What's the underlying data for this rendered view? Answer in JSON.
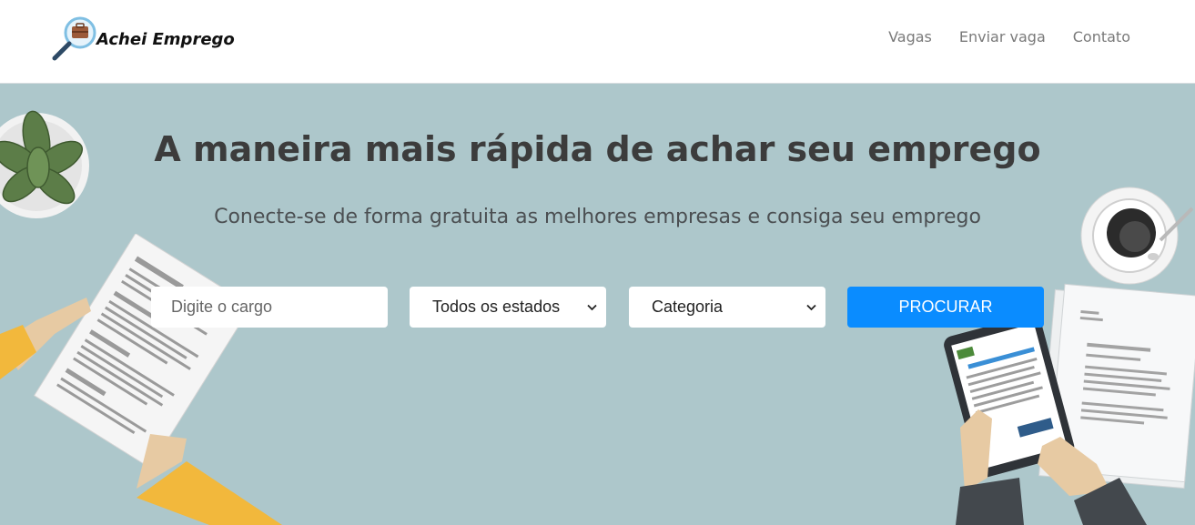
{
  "brand": {
    "name": "Achei Emprego"
  },
  "nav": {
    "items": [
      {
        "label": "Vagas"
      },
      {
        "label": "Enviar vaga"
      },
      {
        "label": "Contato"
      }
    ]
  },
  "hero": {
    "title": "A maneira mais rápida de achar seu emprego",
    "subtitle": "Conecte-se de forma gratuita as melhores empresas e consiga seu emprego"
  },
  "search": {
    "placeholder": "Digite o cargo",
    "states_selected": "Todos os estados",
    "category_selected": "Categoria",
    "button_label": "PROCURAR"
  },
  "colors": {
    "hero_background": "#adc7cb",
    "button_primary": "#0a8cff",
    "title_text": "#3c3c3c",
    "nav_text": "#7a7a7a"
  },
  "illustration_icons": [
    "potted-plant-icon",
    "coffee-cup-icon",
    "resume-paper-icon",
    "tablet-icon"
  ]
}
